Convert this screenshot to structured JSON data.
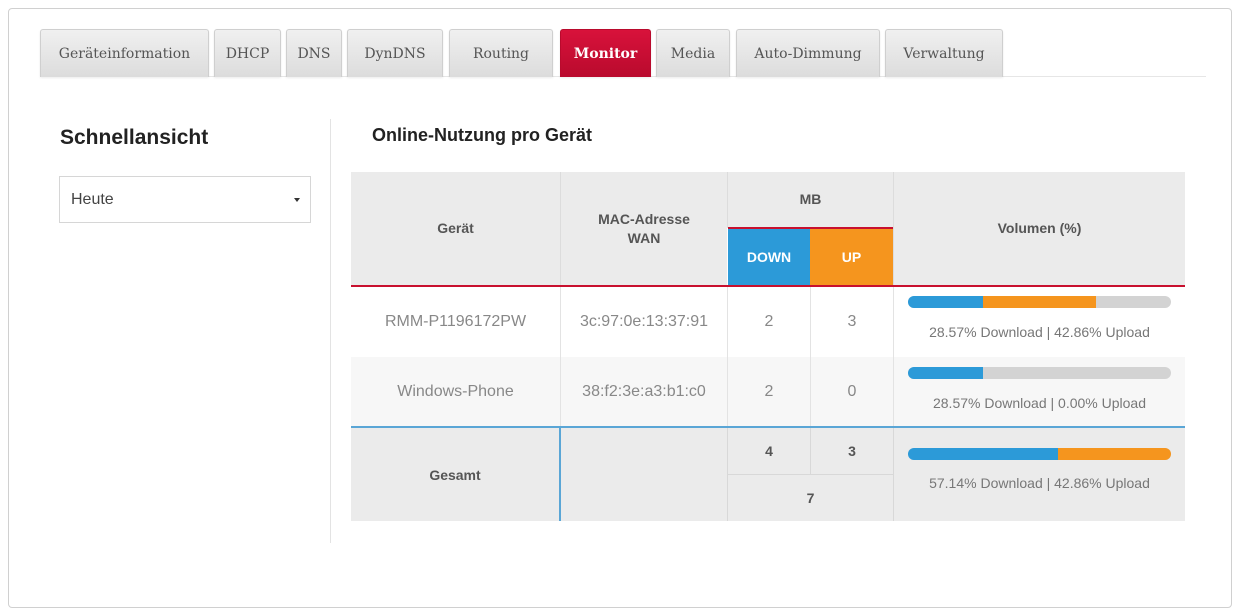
{
  "tabs": [
    {
      "label": "Geräteinformation",
      "active": false
    },
    {
      "label": "DHCP",
      "active": false
    },
    {
      "label": "DNS",
      "active": false
    },
    {
      "label": "DynDNS",
      "active": false
    },
    {
      "label": "Routing",
      "active": false
    },
    {
      "label": "Monitor",
      "active": true
    },
    {
      "label": "Media",
      "active": false
    },
    {
      "label": "Auto-Dimmung",
      "active": false
    },
    {
      "label": "Verwaltung",
      "active": false
    }
  ],
  "sidebar": {
    "title": "Schnellansicht",
    "period_select": {
      "value": "Heute"
    }
  },
  "main": {
    "title": "Online-Nutzung pro Gerät",
    "table": {
      "headers": {
        "device": "Gerät",
        "mac_line1": "MAC-Adresse",
        "mac_line2": "WAN",
        "mb": "MB",
        "down": "DOWN",
        "up": "UP",
        "volume": "Volumen (%)"
      },
      "rows": [
        {
          "device": "RMM-P1196172PW",
          "mac": "3c:97:0e:13:37:91",
          "down": "2",
          "up": "3",
          "download_pct": 28.57,
          "upload_pct": 42.86,
          "volume_label": "28.57% Download | 42.86% Upload"
        },
        {
          "device": "Windows-Phone",
          "mac": "38:f2:3e:a3:b1:c0",
          "down": "2",
          "up": "0",
          "download_pct": 28.57,
          "upload_pct": 0.0,
          "volume_label": "28.57% Download | 0.00% Upload"
        }
      ],
      "total": {
        "label": "Gesamt",
        "down": "4",
        "up": "3",
        "sum": "7",
        "download_pct": 57.14,
        "upload_pct": 42.86,
        "volume_label": "57.14% Download | 42.86% Upload"
      }
    }
  },
  "colors": {
    "accent_red": "#c8102e",
    "download_blue": "#2c9ad8",
    "upload_orange": "#f5951e",
    "bar_track": "#d3d3d3"
  }
}
